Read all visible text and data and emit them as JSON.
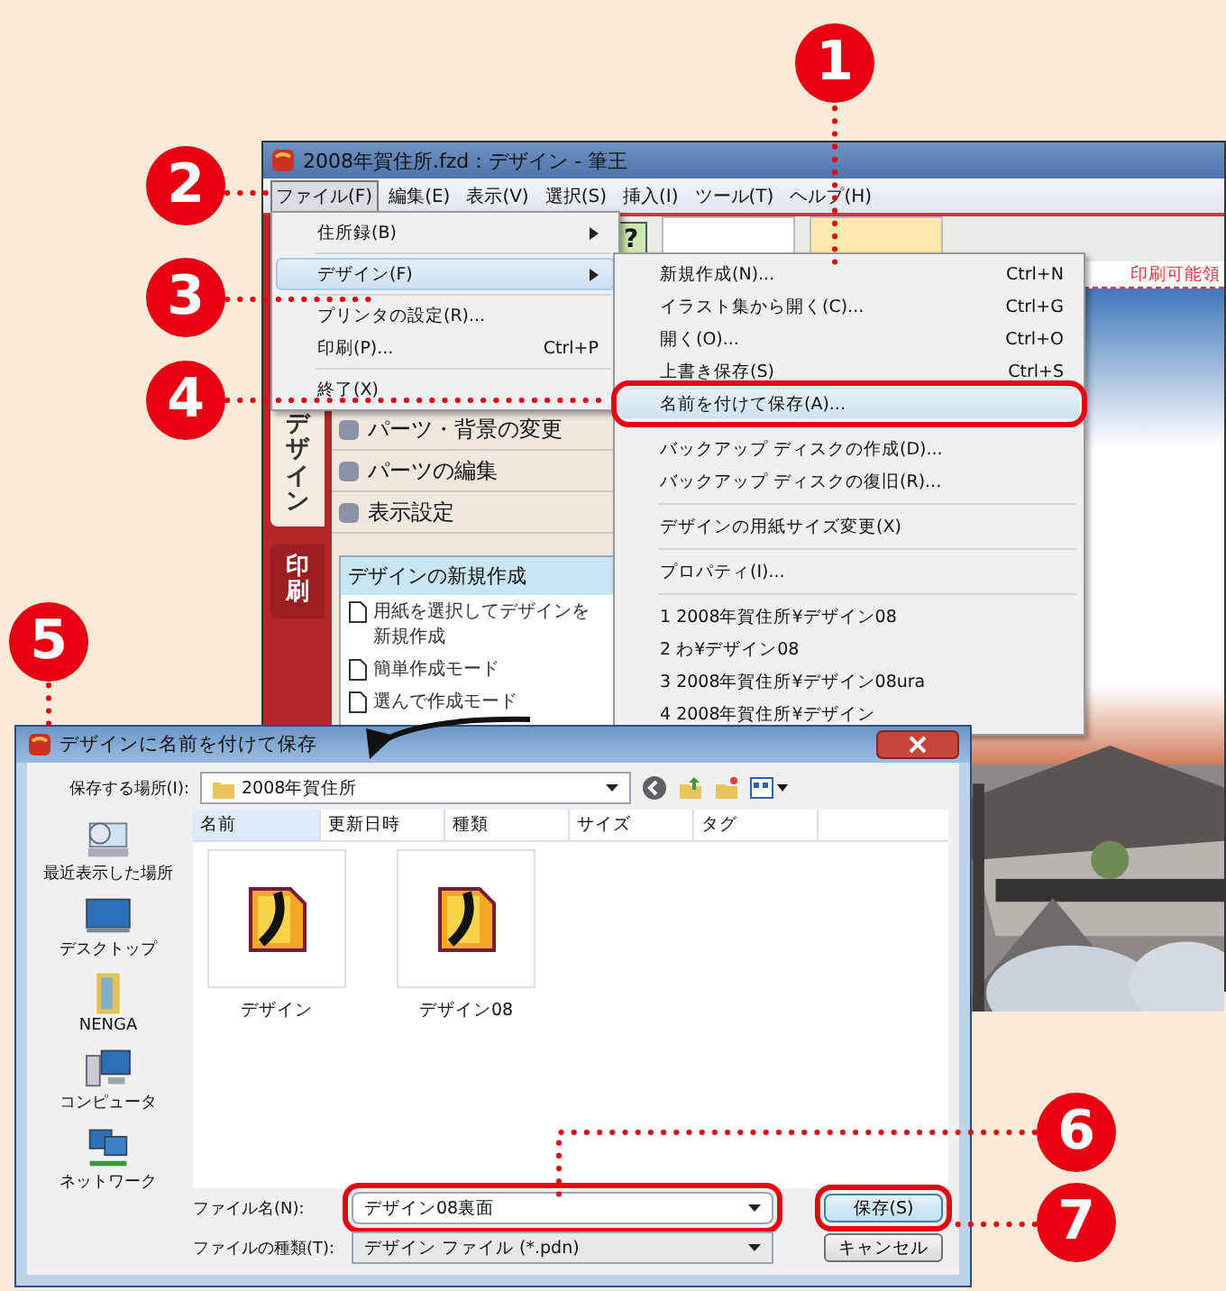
{
  "app_window": {
    "title": "2008年賀住所.fzd：デザイン - 筆王",
    "menu": [
      {
        "label": "ファイル(F)",
        "selected": true
      },
      {
        "label": "編集(E)",
        "selected": false
      },
      {
        "label": "表示(V)",
        "selected": false
      },
      {
        "label": "選択(S)",
        "selected": false
      },
      {
        "label": "挿入(I)",
        "selected": false
      },
      {
        "label": "ツール(T)",
        "selected": false
      },
      {
        "label": "ヘルプ(H)",
        "selected": false
      }
    ],
    "help_button": "?",
    "print_area_label": "印刷可能領"
  },
  "sidebar": {
    "tabs": [
      {
        "label": "デザイン",
        "selected": true
      },
      {
        "label": "印刷",
        "selected": false
      }
    ],
    "sections": [
      "パーツ・背景の変更",
      "パーツの編集",
      "表示設定"
    ],
    "panel": {
      "title": "デザインの新規作成",
      "items": [
        "用紙を選択してデザインを新規作成",
        "簡単作成モード",
        "選んで作成モード"
      ]
    }
  },
  "file_menu": [
    {
      "kind": "item",
      "label": "住所録(B)",
      "submenu": true,
      "selected": false
    },
    {
      "kind": "separator"
    },
    {
      "kind": "item",
      "label": "デザイン(F)",
      "submenu": true,
      "selected": true
    },
    {
      "kind": "separator"
    },
    {
      "kind": "item",
      "label": "プリンタの設定(R)...",
      "selected": false
    },
    {
      "kind": "item",
      "label": "印刷(P)...",
      "shortcut": "Ctrl+P",
      "selected": false
    },
    {
      "kind": "separator"
    },
    {
      "kind": "item",
      "label": "終了(X)",
      "selected": false
    }
  ],
  "design_submenu": [
    {
      "kind": "item",
      "label": "新規作成(N)...",
      "shortcut": "Ctrl+N",
      "marked": false
    },
    {
      "kind": "item",
      "label": "イラスト集から開く(C)...",
      "shortcut": "Ctrl+G",
      "marked": false
    },
    {
      "kind": "item",
      "label": "開く(O)...",
      "shortcut": "Ctrl+O",
      "marked": false
    },
    {
      "kind": "item",
      "label": "上書き保存(S)",
      "shortcut": "Ctrl+S",
      "marked": false
    },
    {
      "kind": "item",
      "label": "名前を付けて保存(A)...",
      "marked": true
    },
    {
      "kind": "separator"
    },
    {
      "kind": "item",
      "label": "バックアップ ディスクの作成(D)...",
      "marked": false
    },
    {
      "kind": "item",
      "label": "バックアップ ディスクの復旧(R)...",
      "marked": false
    },
    {
      "kind": "separator"
    },
    {
      "kind": "item",
      "label": "デザインの用紙サイズ変更(X)",
      "marked": false
    },
    {
      "kind": "separator"
    },
    {
      "kind": "item",
      "label": "プロパティ(I)...",
      "marked": false
    },
    {
      "kind": "separator"
    },
    {
      "kind": "item",
      "label": "1  2008年賀住所¥デザイン08",
      "marked": false
    },
    {
      "kind": "item",
      "label": "2  わ¥デザイン08",
      "marked": false
    },
    {
      "kind": "item",
      "label": "3  2008年賀住所¥デザイン08ura",
      "marked": false
    },
    {
      "kind": "item",
      "label": "4  2008年賀住所¥デザイン",
      "marked": false
    }
  ],
  "save_dialog": {
    "title": "デザインに名前を付けて保存",
    "location_label": "保存する場所(I):",
    "location": "2008年賀住所",
    "places": [
      {
        "label": "最近表示した場所",
        "kind": "recent"
      },
      {
        "label": "デスクトップ",
        "kind": "desktop"
      },
      {
        "label": "NENGA",
        "kind": "folder"
      },
      {
        "label": "コンピュータ",
        "kind": "computer"
      },
      {
        "label": "ネットワーク",
        "kind": "network"
      }
    ],
    "columns": [
      {
        "label": "名前",
        "selected": true
      },
      {
        "label": "更新日時",
        "selected": false
      },
      {
        "label": "種類",
        "selected": false
      },
      {
        "label": "サイズ",
        "selected": false
      },
      {
        "label": "タグ",
        "selected": false
      }
    ],
    "files": [
      "デザイン",
      "デザイン08"
    ],
    "filename_label": "ファイル名(N):",
    "filename": "デザイン08裏面",
    "filename_marked": true,
    "filetype_label": "ファイルの種類(T):",
    "filetype": "デザイン ファイル (*.pdn)",
    "buttons": [
      {
        "label": "保存(S)",
        "marked": true
      },
      {
        "label": "キャンセル",
        "marked": false
      }
    ]
  },
  "callouts": [
    {
      "number": "1"
    },
    {
      "number": "2"
    },
    {
      "number": "3"
    },
    {
      "number": "4"
    },
    {
      "number": "5"
    },
    {
      "number": "6"
    },
    {
      "number": "7"
    }
  ]
}
